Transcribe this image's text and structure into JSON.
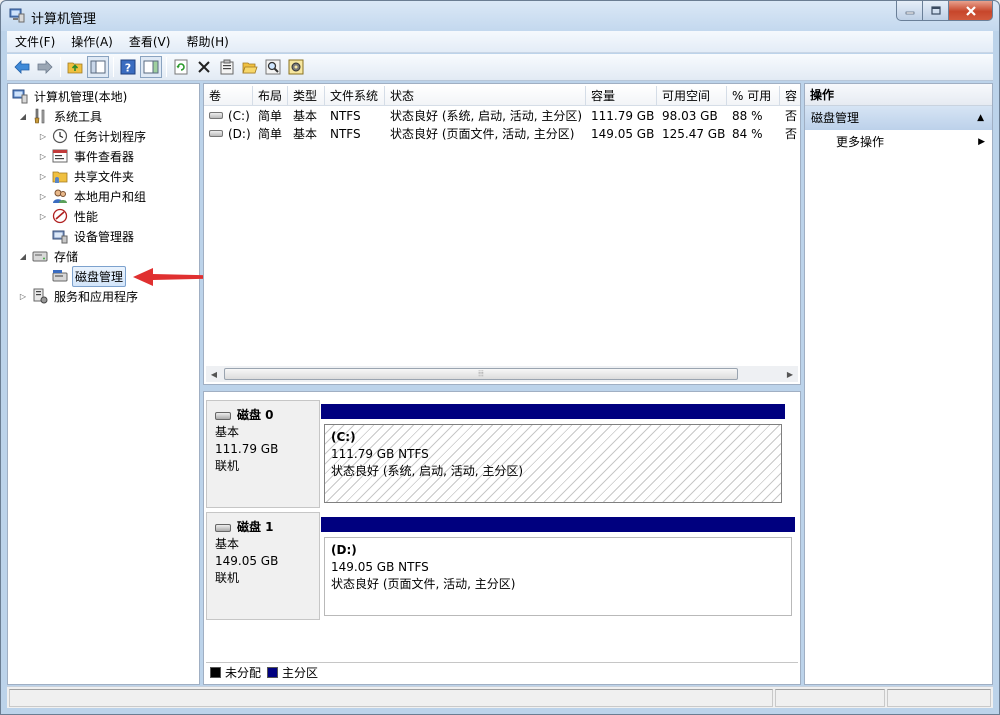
{
  "window": {
    "title": "计算机管理"
  },
  "menu": [
    "文件(F)",
    "操作(A)",
    "查看(V)",
    "帮助(H)"
  ],
  "toolbar": {
    "buttons": [
      "back-icon",
      "forward-icon",
      "up-folder-icon",
      "show-hide-tree-icon",
      "help-icon",
      "show-hide-action-pane-icon",
      "refresh-icon",
      "delete-icon",
      "properties-icon",
      "open-icon",
      "search-icon",
      "settings-icon"
    ]
  },
  "tree": {
    "root": "计算机管理(本地)",
    "system_tools": "系统工具",
    "task_scheduler": "任务计划程序",
    "event_viewer": "事件查看器",
    "shared_folders": "共享文件夹",
    "local_users": "本地用户和组",
    "performance": "性能",
    "device_manager": "设备管理器",
    "storage": "存储",
    "disk_management": "磁盘管理",
    "services_apps": "服务和应用程序"
  },
  "volume_list": {
    "columns": [
      "卷",
      "布局",
      "类型",
      "文件系统",
      "状态",
      "容量",
      "可用空间",
      "% 可用",
      "容"
    ],
    "rows": [
      {
        "volume": "(C:)",
        "layout": "简单",
        "type": "基本",
        "fs": "NTFS",
        "status": "状态良好 (系统, 启动, 活动, 主分区)",
        "capacity": "111.79 GB",
        "free": "98.03 GB",
        "pct": "88 %",
        "fault": "否"
      },
      {
        "volume": "(D:)",
        "layout": "简单",
        "type": "基本",
        "fs": "NTFS",
        "status": "状态良好 (页面文件, 活动, 主分区)",
        "capacity": "149.05 GB",
        "free": "125.47 GB",
        "pct": "84 %",
        "fault": "否"
      }
    ],
    "scroll_grip": "⦙⦙⦙"
  },
  "disks": [
    {
      "name": "磁盘 0",
      "type": "基本",
      "size": "111.79 GB",
      "state": "联机",
      "partition": {
        "label": "(C:)",
        "size_fs": "111.79 GB NTFS",
        "status": "状态良好 (系统, 启动, 活动, 主分区)"
      }
    },
    {
      "name": "磁盘 1",
      "type": "基本",
      "size": "149.05 GB",
      "state": "联机",
      "partition": {
        "label": "(D:)",
        "size_fs": "149.05 GB NTFS",
        "status": "状态良好 (页面文件, 活动, 主分区)"
      }
    }
  ],
  "legend": {
    "unallocated": "未分配",
    "unallocated_color": "#000000",
    "primary": "主分区",
    "primary_color": "#00007f"
  },
  "actions": {
    "title": "操作",
    "section": "磁盘管理",
    "more": "更多操作"
  },
  "colors": {
    "partition_header": "#00007f",
    "selection_border": "#7da2ce",
    "annotation_arrow": "#e03030"
  }
}
